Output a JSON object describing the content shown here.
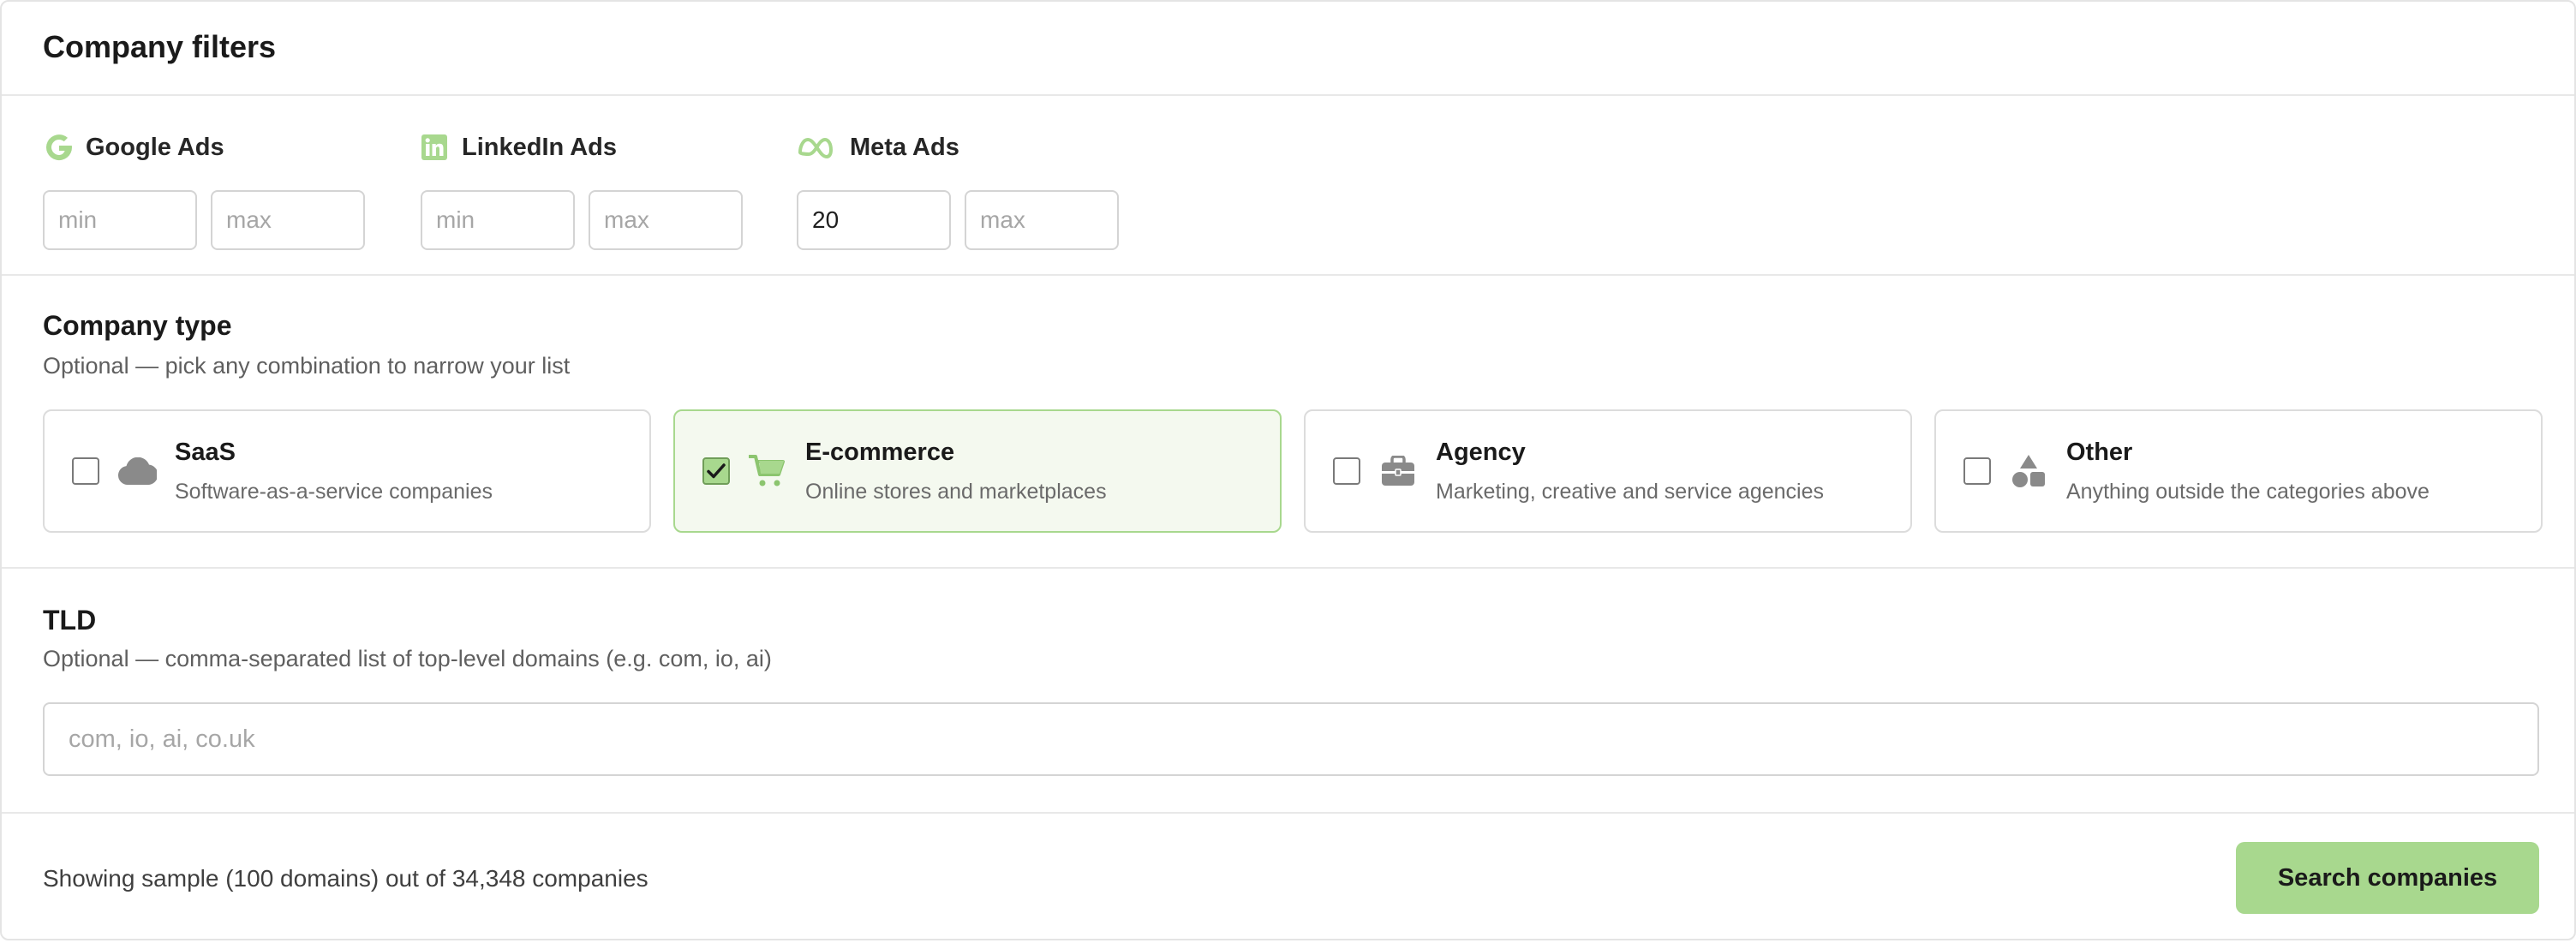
{
  "header": {
    "title": "Company filters"
  },
  "ads": [
    {
      "label": "Google Ads",
      "icon": "google-icon",
      "min_placeholder": "min",
      "max_placeholder": "max",
      "min_value": "",
      "max_value": ""
    },
    {
      "label": "LinkedIn Ads",
      "icon": "linkedin-icon",
      "min_placeholder": "min",
      "max_placeholder": "max",
      "min_value": "",
      "max_value": ""
    },
    {
      "label": "Meta Ads",
      "icon": "meta-icon",
      "min_placeholder": "min",
      "max_placeholder": "max",
      "min_value": "20",
      "max_value": ""
    }
  ],
  "company_type": {
    "title": "Company type",
    "subtitle": "Optional — pick any combination to narrow your list",
    "options": [
      {
        "title": "SaaS",
        "description": "Software-as-a-service companies",
        "icon": "cloud-icon",
        "checked": false
      },
      {
        "title": "E-commerce",
        "description": "Online stores and marketplaces",
        "icon": "cart-icon",
        "checked": true
      },
      {
        "title": "Agency",
        "description": "Marketing, creative and service agencies",
        "icon": "briefcase-icon",
        "checked": false
      },
      {
        "title": "Other",
        "description": "Anything outside the categories above",
        "icon": "shapes-icon",
        "checked": false
      }
    ]
  },
  "tld": {
    "title": "TLD",
    "subtitle": "Optional — comma-separated list of top-level domains (e.g. com, io, ai)",
    "placeholder": "com, io, ai, co.uk",
    "value": ""
  },
  "footer": {
    "status": "Showing sample (100 domains) out of 34,348 companies",
    "search_label": "Search companies"
  },
  "colors": {
    "accent": "#a8d88e",
    "selected_bg": "#f4f9ef",
    "border": "#dcdcdc"
  }
}
